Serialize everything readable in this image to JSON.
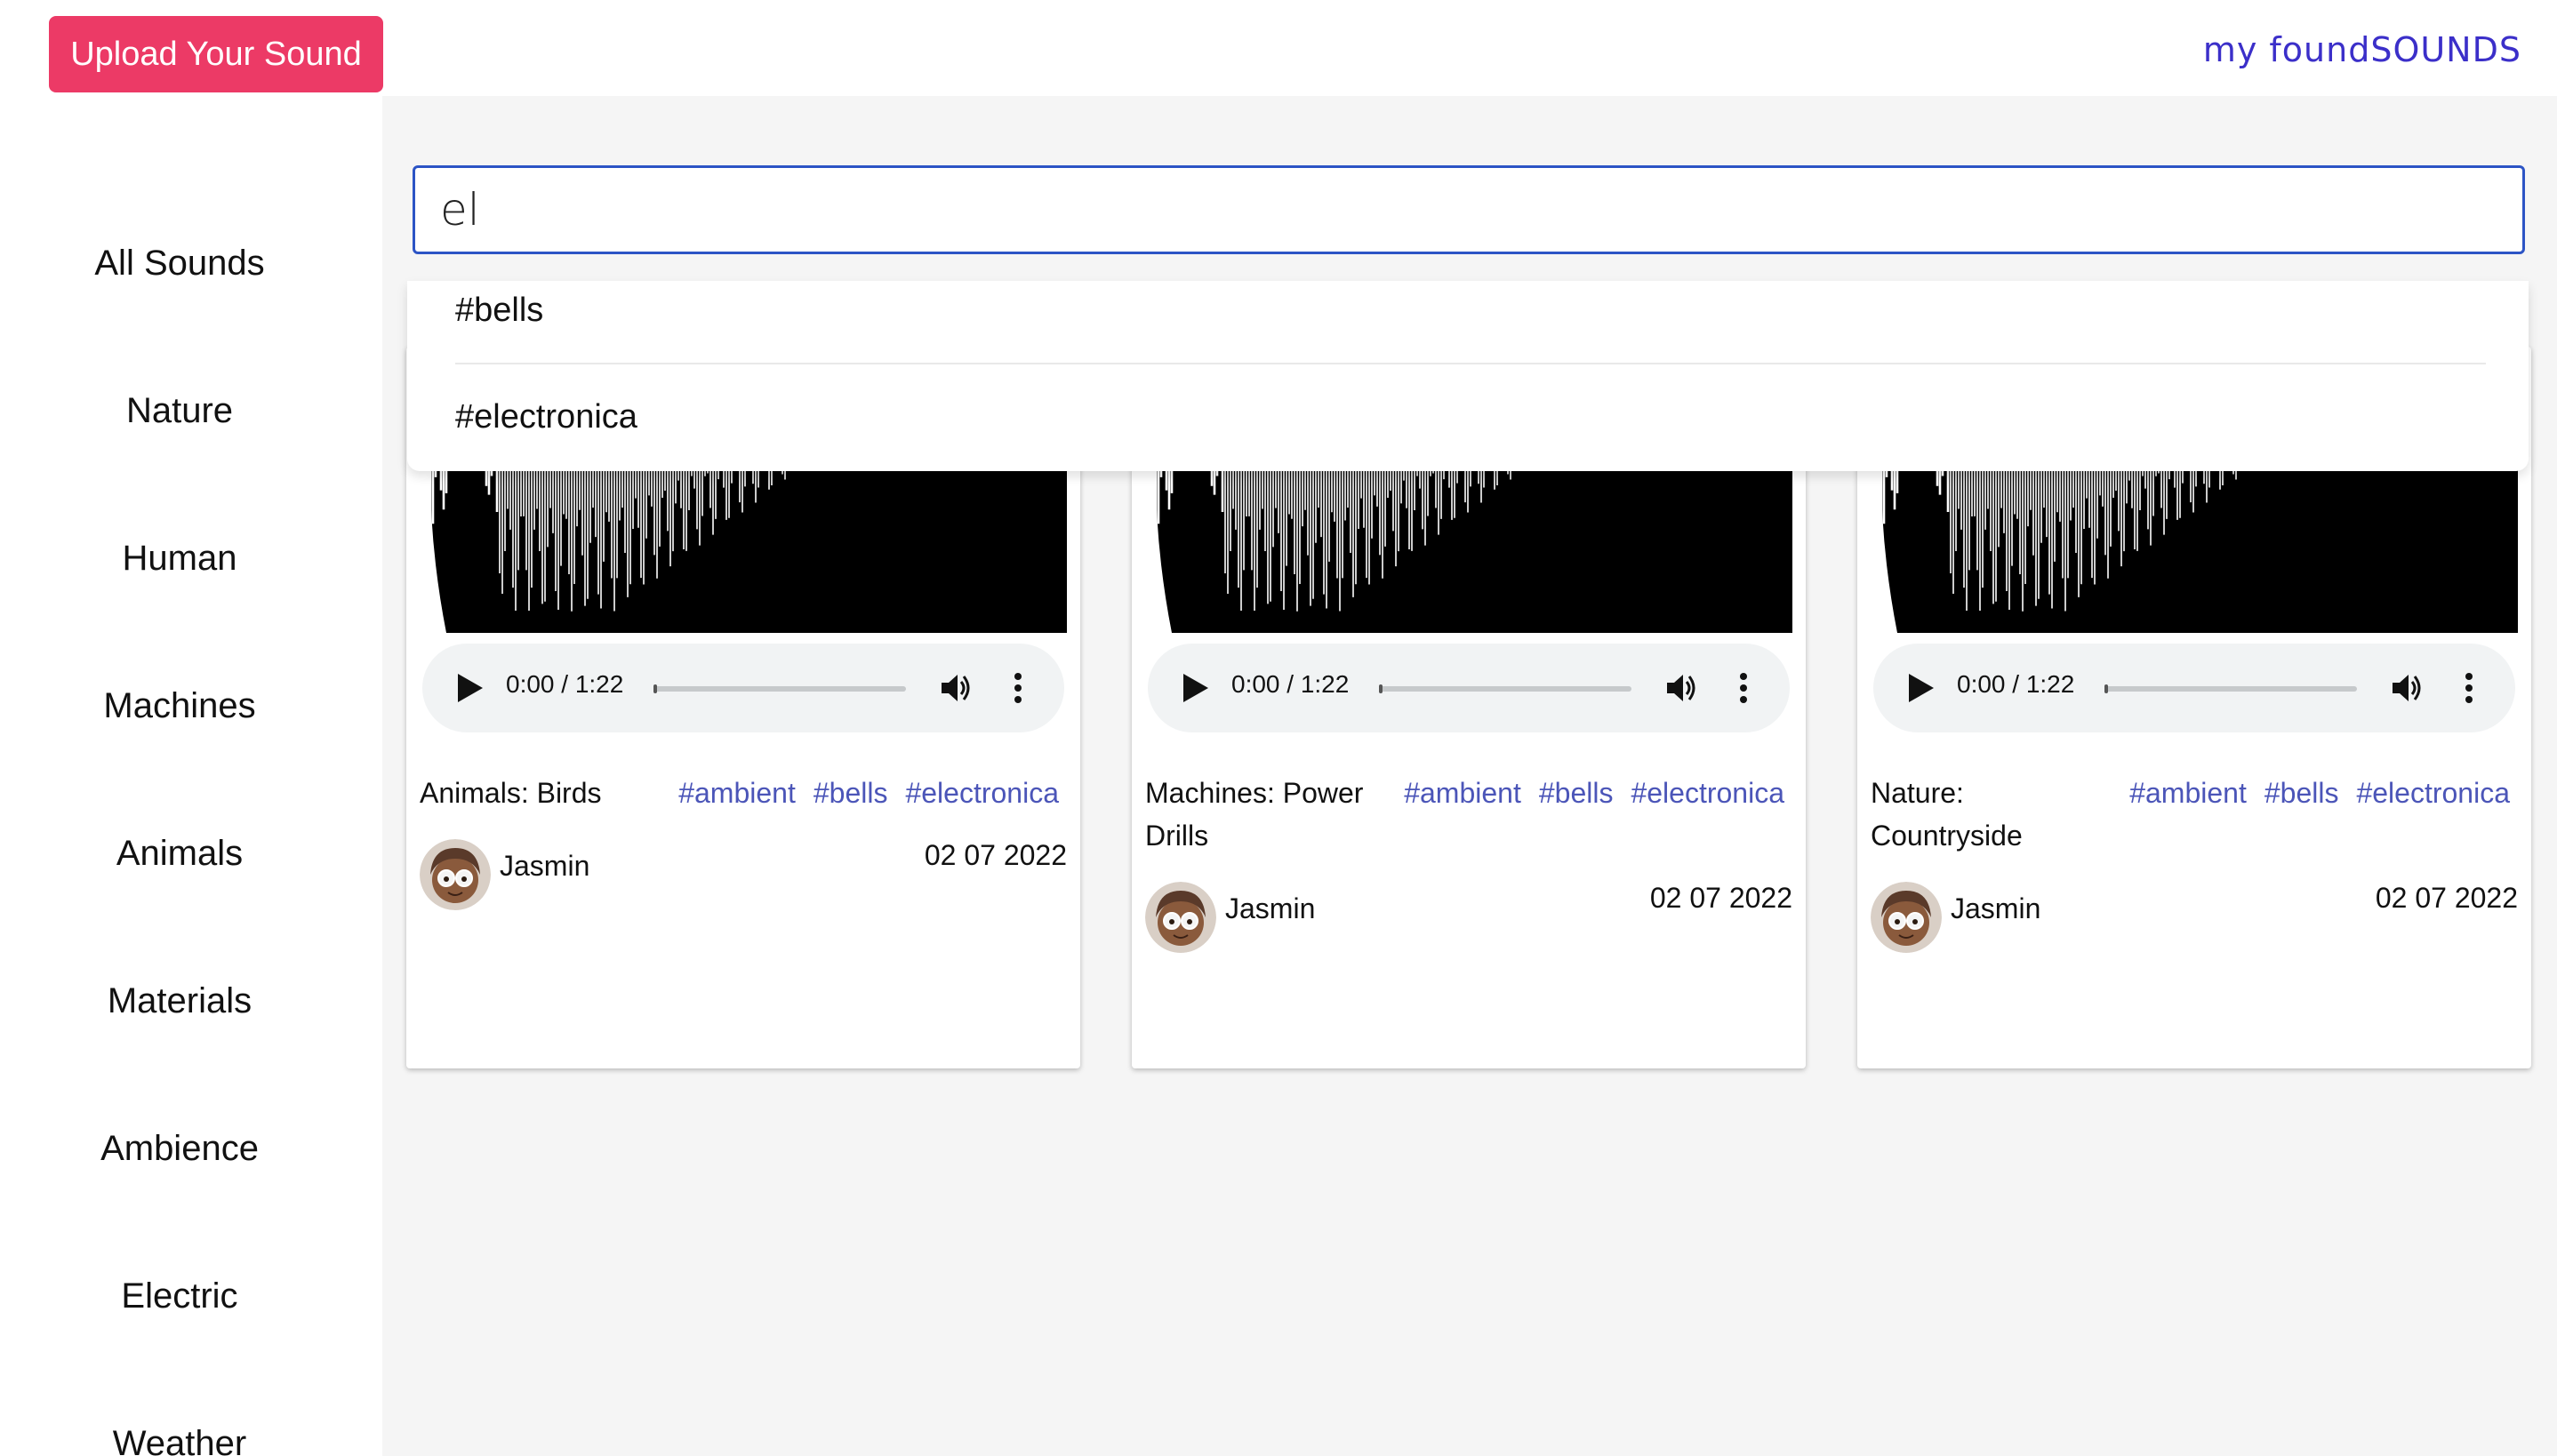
{
  "header": {
    "upload_label": "Upload Your Sound",
    "logo_my": "my",
    "logo_found": "foundSOUNDS",
    "accent": "#ec3a66",
    "brand_blue": "#3b2fc9"
  },
  "sidebar": {
    "items": [
      {
        "label": "All Sounds"
      },
      {
        "label": "Nature"
      },
      {
        "label": "Human"
      },
      {
        "label": "Machines"
      },
      {
        "label": "Animals"
      },
      {
        "label": "Materials"
      },
      {
        "label": "Ambience"
      },
      {
        "label": "Electric"
      },
      {
        "label": "Weather"
      }
    ]
  },
  "search": {
    "value": "el",
    "suggestions": [
      "#bells",
      "#electronica"
    ]
  },
  "cards": [
    {
      "title": "Animals: Birds",
      "time": "0:00 / 1:22",
      "tags": [
        "#ambient",
        "#bells",
        "#electronica"
      ],
      "author": "Jasmin",
      "date": "02 07 2022",
      "progress": 0
    },
    {
      "title": "Machines: Power Drills",
      "time": "0:00 / 1:22",
      "tags": [
        "#ambient",
        "#bells",
        "#electronica"
      ],
      "author": "Jasmin",
      "date": "02 07 2022",
      "progress": 0
    },
    {
      "title": "Nature: Countryside",
      "time": "0:00 / 1:22",
      "tags": [
        "#ambient",
        "#bells",
        "#electronica"
      ],
      "author": "Jasmin",
      "date": "02 07 2022",
      "progress": 0
    }
  ],
  "icons": {
    "play": "play-icon",
    "volume": "volume-icon",
    "more": "more-vert-icon",
    "logo": "sound-wave-icon"
  }
}
